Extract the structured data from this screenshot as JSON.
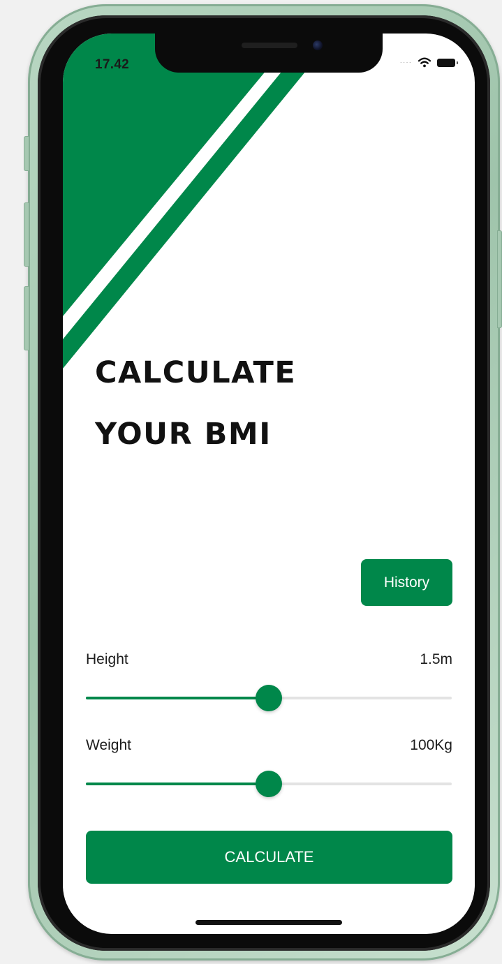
{
  "status_bar": {
    "time": "17.42",
    "signal_icon": "signal-dots-icon",
    "wifi_icon": "wifi-icon",
    "battery_icon": "battery-icon"
  },
  "header": {
    "title_line1": "CALCULATE",
    "title_line2": "YOUR BMI"
  },
  "history_button": {
    "label": "History"
  },
  "height": {
    "label": "Height",
    "value": "1.5m",
    "slider_fraction": 0.5
  },
  "weight": {
    "label": "Weight",
    "value": "100Kg",
    "slider_fraction": 0.5
  },
  "calculate_button": {
    "label": "CALCULATE"
  },
  "colors": {
    "accent": "#00874a",
    "track": "#e3e3e3",
    "background": "#ffffff",
    "text": "#1c1c1c",
    "phone_frame": "#a6c8b1"
  }
}
